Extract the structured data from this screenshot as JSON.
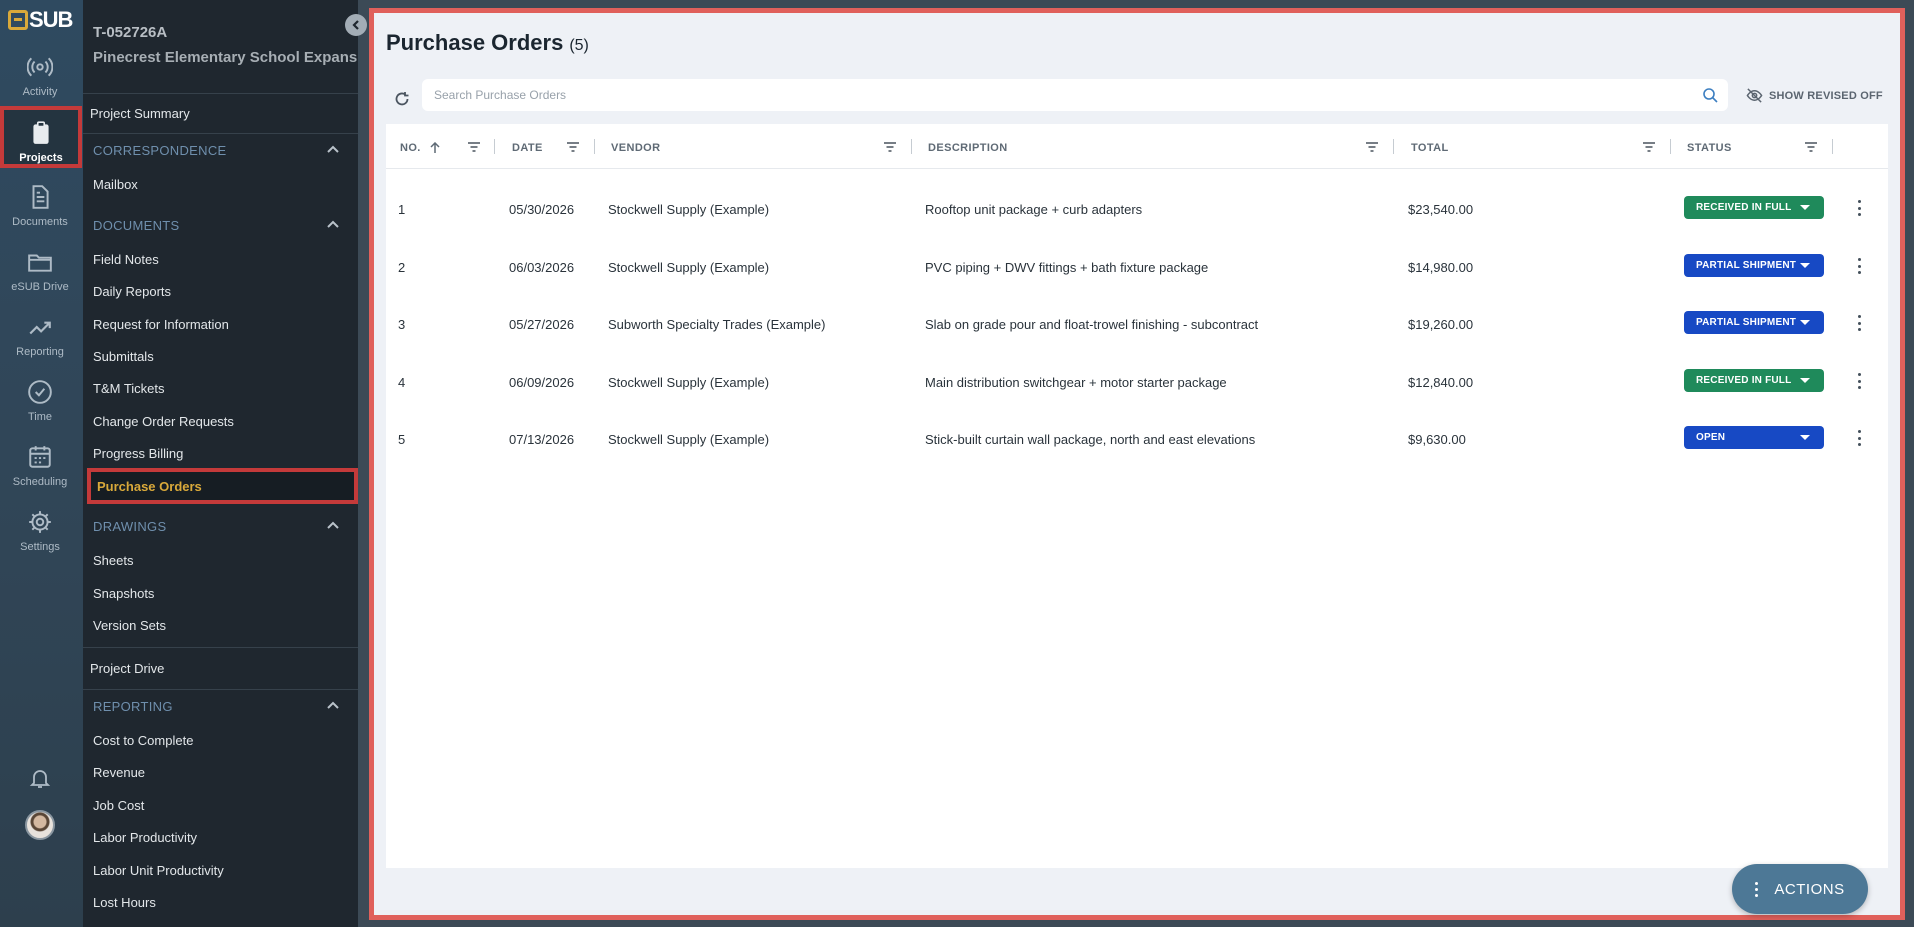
{
  "app": {
    "logo_text": "SUB"
  },
  "rail": {
    "items": [
      {
        "label": "Activity",
        "icon": "activity-icon"
      },
      {
        "label": "Projects",
        "icon": "clipboard-icon"
      },
      {
        "label": "Documents",
        "icon": "document-icon"
      },
      {
        "label": "eSUB Drive",
        "icon": "folder-icon"
      },
      {
        "label": "Reporting",
        "icon": "chart-icon"
      },
      {
        "label": "Time",
        "icon": "clock-icon"
      },
      {
        "label": "Scheduling",
        "icon": "calendar-icon"
      },
      {
        "label": "Settings",
        "icon": "gear-icon"
      }
    ],
    "active": "Projects"
  },
  "project": {
    "number": "T-052726A",
    "name": "Pinecrest Elementary School Expansion"
  },
  "sidebar": {
    "project_summary": "Project Summary",
    "correspondence": {
      "title": "CORRESPONDENCE",
      "items": [
        "Mailbox"
      ]
    },
    "documents": {
      "title": "DOCUMENTS",
      "items": [
        "Field Notes",
        "Daily Reports",
        "Request for Information",
        "Submittals",
        "T&M Tickets",
        "Change Order Requests",
        "Progress Billing",
        "Purchase Orders"
      ]
    },
    "drawings": {
      "title": "DRAWINGS",
      "items": [
        "Sheets",
        "Snapshots",
        "Version Sets"
      ]
    },
    "project_drive": "Project Drive",
    "reporting": {
      "title": "REPORTING",
      "items": [
        "Cost to Complete",
        "Revenue",
        "Job Cost",
        "Labor Productivity",
        "Labor Unit Productivity",
        "Lost Hours"
      ]
    },
    "active_item": "Purchase Orders"
  },
  "main": {
    "title": "Purchase Orders",
    "count": "(5)",
    "search_placeholder": "Search Purchase Orders",
    "show_revised": "SHOW REVISED OFF",
    "actions_label": "ACTIONS"
  },
  "table": {
    "columns": [
      "NO.",
      "DATE",
      "VENDOR",
      "DESCRIPTION",
      "TOTAL",
      "STATUS"
    ],
    "rows": [
      {
        "no": "1",
        "date": "05/30/2026",
        "vendor": "Stockwell Supply (Example)",
        "description": "Rooftop unit package + curb adapters",
        "total": "$23,540.00",
        "status": "RECEIVED IN FULL"
      },
      {
        "no": "2",
        "date": "06/03/2026",
        "vendor": "Stockwell Supply (Example)",
        "description": "PVC piping + DWV fittings + bath fixture package",
        "total": "$14,980.00",
        "status": "PARTIAL SHIPMENT"
      },
      {
        "no": "3",
        "date": "05/27/2026",
        "vendor": "Subworth Specialty Trades (Example)",
        "description": "Slab on grade pour and float-trowel finishing - subcontract",
        "total": "$19,260.00",
        "status": "PARTIAL SHIPMENT"
      },
      {
        "no": "4",
        "date": "06/09/2026",
        "vendor": "Stockwell Supply (Example)",
        "description": "Main distribution switchgear + motor starter package",
        "total": "$12,840.00",
        "status": "RECEIVED IN FULL"
      },
      {
        "no": "5",
        "date": "07/13/2026",
        "vendor": "Stockwell Supply (Example)",
        "description": "Stick-built curtain wall package, north and east elevations",
        "total": "$9,630.00",
        "status": "OPEN"
      }
    ]
  },
  "colors": {
    "received": "#1f8a5b",
    "partial": "#1749c4",
    "open": "#1749c4",
    "accent": "#d9a93a",
    "highlight_border": "#c43a3a"
  }
}
